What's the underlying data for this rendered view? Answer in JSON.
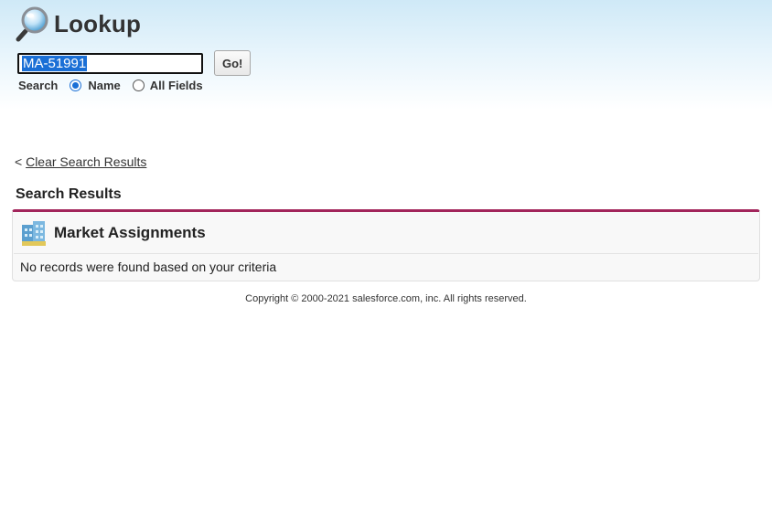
{
  "header": {
    "title": "Lookup",
    "icon": "magnifier-icon"
  },
  "search": {
    "input_value": "MA-51991",
    "go_label": "Go!",
    "scope_label": "Search",
    "options": [
      {
        "label": "Name",
        "checked": true
      },
      {
        "label": "All Fields",
        "checked": false
      }
    ]
  },
  "clear": {
    "prefix": "<",
    "link_label": "Clear Search Results"
  },
  "results": {
    "heading": "Search Results",
    "panel_title": "Market Assignments",
    "panel_icon": "building-icon",
    "empty_message": "No records were found based on your criteria",
    "accent_color": "#a2255b"
  },
  "footer": {
    "copyright": "Copyright © 2000-2021 salesforce.com, inc. All rights reserved."
  }
}
